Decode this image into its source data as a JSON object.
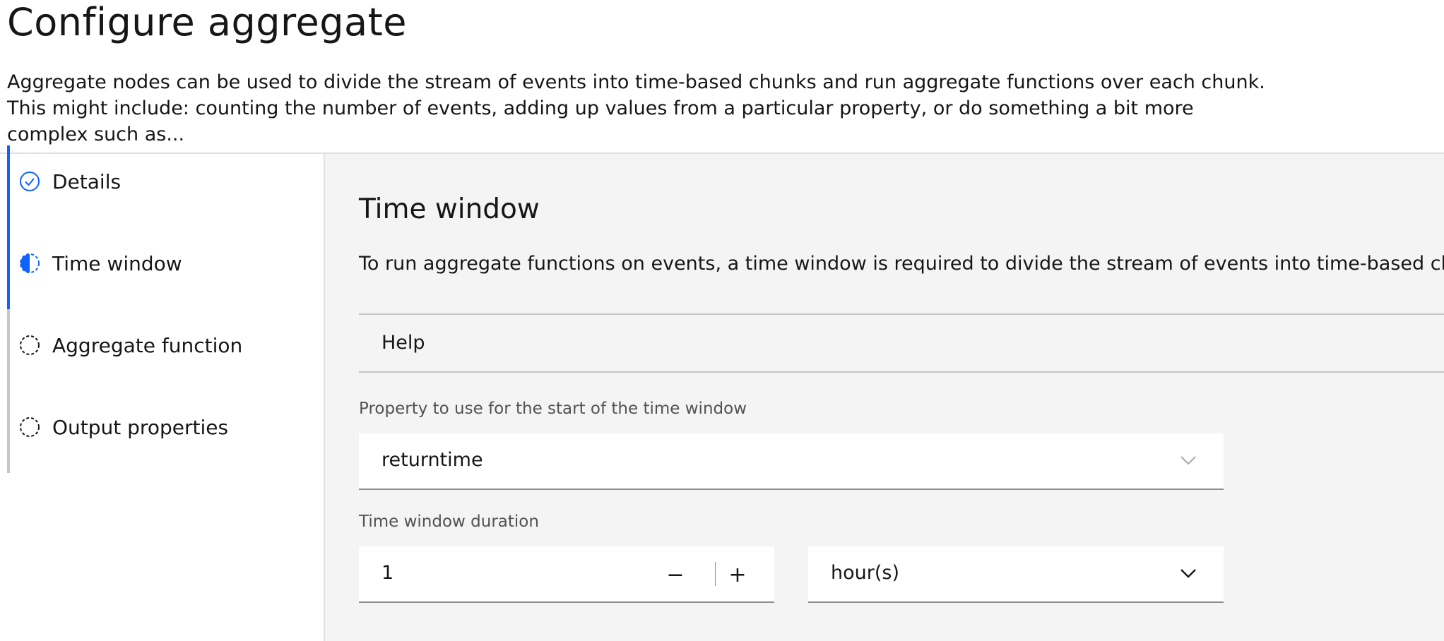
{
  "header": {
    "title": "Configure aggregate",
    "description": "Aggregate nodes can be used to divide the stream of events into time-based chunks and run aggregate functions over each chunk. This might include: counting the number of events, adding up values from a particular property, or do something a bit more complex such as..."
  },
  "steps": [
    {
      "label": "Details",
      "state": "complete",
      "icon": "checkmark-circle-icon"
    },
    {
      "label": "Time window",
      "state": "current",
      "icon": "half-circle-icon"
    },
    {
      "label": "Aggregate function",
      "state": "incomplete",
      "icon": "dashed-circle-icon"
    },
    {
      "label": "Output properties",
      "state": "incomplete",
      "icon": "dashed-circle-icon"
    }
  ],
  "main": {
    "title": "Time window",
    "description": "To run aggregate functions on events, a time window is required to divide the stream of events into time-based chunks.",
    "help_label": "Help",
    "start_property": {
      "label": "Property to use for the start of the time window",
      "value": "returntime"
    },
    "duration": {
      "label": "Time window duration",
      "value": "1",
      "decrement": "−",
      "increment": "+",
      "unit": "hour(s)"
    }
  },
  "colors": {
    "accent": "#0f62fe",
    "panel_bg": "#f4f4f4",
    "inactive_bar": "#c6c6c6"
  }
}
